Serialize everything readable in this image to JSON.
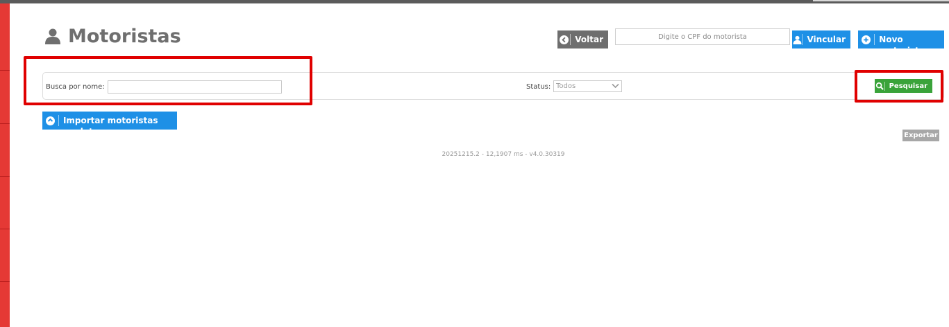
{
  "page": {
    "title": "Motoristas"
  },
  "header": {
    "back_label": "Voltar",
    "cpf_placeholder": "Digite o CPF do motorista",
    "link_label": "Vincular",
    "new_label": "Novo motorista"
  },
  "filters": {
    "name_label": "Busca por nome:",
    "name_value": "",
    "status_label": "Status:",
    "status_selected": "Todos",
    "search_label": "Pesquisar"
  },
  "actions": {
    "import_label": "Importar motoristas em lote",
    "export_label": "Exportar"
  },
  "footer": {
    "version": "20251215.2 - 12,1907 ms - v4.0.30319"
  },
  "colors": {
    "sidebar": "#e53935",
    "primary_blue": "#1e90e6",
    "success_green": "#3aa33a",
    "dark_button": "#6e6e6e",
    "highlight_red": "#e00000"
  }
}
